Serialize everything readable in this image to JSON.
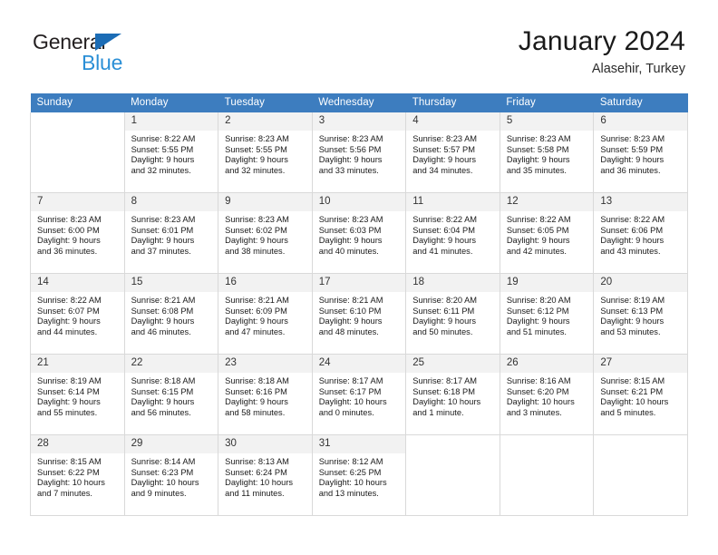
{
  "brand": {
    "name_part1": "General",
    "name_part2": "Blue",
    "accent_color": "#2b8fd6",
    "triangle_color": "#1b6cb5"
  },
  "header": {
    "title": "January 2024",
    "subtitle": "Alasehir, Turkey",
    "header_bg": "#3d7dbf"
  },
  "weekdays": [
    "Sunday",
    "Monday",
    "Tuesday",
    "Wednesday",
    "Thursday",
    "Friday",
    "Saturday"
  ],
  "labels": {
    "sunrise_prefix": "Sunrise:",
    "sunset_prefix": "Sunset:",
    "daylight_prefix": "Daylight:"
  },
  "weeks": [
    [
      {
        "day": "",
        "sunrise": "",
        "sunset": "",
        "daylight_line1": "",
        "daylight_line2": ""
      },
      {
        "day": "1",
        "sunrise": "Sunrise: 8:22 AM",
        "sunset": "Sunset: 5:55 PM",
        "daylight_line1": "Daylight: 9 hours",
        "daylight_line2": "and 32 minutes."
      },
      {
        "day": "2",
        "sunrise": "Sunrise: 8:23 AM",
        "sunset": "Sunset: 5:55 PM",
        "daylight_line1": "Daylight: 9 hours",
        "daylight_line2": "and 32 minutes."
      },
      {
        "day": "3",
        "sunrise": "Sunrise: 8:23 AM",
        "sunset": "Sunset: 5:56 PM",
        "daylight_line1": "Daylight: 9 hours",
        "daylight_line2": "and 33 minutes."
      },
      {
        "day": "4",
        "sunrise": "Sunrise: 8:23 AM",
        "sunset": "Sunset: 5:57 PM",
        "daylight_line1": "Daylight: 9 hours",
        "daylight_line2": "and 34 minutes."
      },
      {
        "day": "5",
        "sunrise": "Sunrise: 8:23 AM",
        "sunset": "Sunset: 5:58 PM",
        "daylight_line1": "Daylight: 9 hours",
        "daylight_line2": "and 35 minutes."
      },
      {
        "day": "6",
        "sunrise": "Sunrise: 8:23 AM",
        "sunset": "Sunset: 5:59 PM",
        "daylight_line1": "Daylight: 9 hours",
        "daylight_line2": "and 36 minutes."
      }
    ],
    [
      {
        "day": "7",
        "sunrise": "Sunrise: 8:23 AM",
        "sunset": "Sunset: 6:00 PM",
        "daylight_line1": "Daylight: 9 hours",
        "daylight_line2": "and 36 minutes."
      },
      {
        "day": "8",
        "sunrise": "Sunrise: 8:23 AM",
        "sunset": "Sunset: 6:01 PM",
        "daylight_line1": "Daylight: 9 hours",
        "daylight_line2": "and 37 minutes."
      },
      {
        "day": "9",
        "sunrise": "Sunrise: 8:23 AM",
        "sunset": "Sunset: 6:02 PM",
        "daylight_line1": "Daylight: 9 hours",
        "daylight_line2": "and 38 minutes."
      },
      {
        "day": "10",
        "sunrise": "Sunrise: 8:23 AM",
        "sunset": "Sunset: 6:03 PM",
        "daylight_line1": "Daylight: 9 hours",
        "daylight_line2": "and 40 minutes."
      },
      {
        "day": "11",
        "sunrise": "Sunrise: 8:22 AM",
        "sunset": "Sunset: 6:04 PM",
        "daylight_line1": "Daylight: 9 hours",
        "daylight_line2": "and 41 minutes."
      },
      {
        "day": "12",
        "sunrise": "Sunrise: 8:22 AM",
        "sunset": "Sunset: 6:05 PM",
        "daylight_line1": "Daylight: 9 hours",
        "daylight_line2": "and 42 minutes."
      },
      {
        "day": "13",
        "sunrise": "Sunrise: 8:22 AM",
        "sunset": "Sunset: 6:06 PM",
        "daylight_line1": "Daylight: 9 hours",
        "daylight_line2": "and 43 minutes."
      }
    ],
    [
      {
        "day": "14",
        "sunrise": "Sunrise: 8:22 AM",
        "sunset": "Sunset: 6:07 PM",
        "daylight_line1": "Daylight: 9 hours",
        "daylight_line2": "and 44 minutes."
      },
      {
        "day": "15",
        "sunrise": "Sunrise: 8:21 AM",
        "sunset": "Sunset: 6:08 PM",
        "daylight_line1": "Daylight: 9 hours",
        "daylight_line2": "and 46 minutes."
      },
      {
        "day": "16",
        "sunrise": "Sunrise: 8:21 AM",
        "sunset": "Sunset: 6:09 PM",
        "daylight_line1": "Daylight: 9 hours",
        "daylight_line2": "and 47 minutes."
      },
      {
        "day": "17",
        "sunrise": "Sunrise: 8:21 AM",
        "sunset": "Sunset: 6:10 PM",
        "daylight_line1": "Daylight: 9 hours",
        "daylight_line2": "and 48 minutes."
      },
      {
        "day": "18",
        "sunrise": "Sunrise: 8:20 AM",
        "sunset": "Sunset: 6:11 PM",
        "daylight_line1": "Daylight: 9 hours",
        "daylight_line2": "and 50 minutes."
      },
      {
        "day": "19",
        "sunrise": "Sunrise: 8:20 AM",
        "sunset": "Sunset: 6:12 PM",
        "daylight_line1": "Daylight: 9 hours",
        "daylight_line2": "and 51 minutes."
      },
      {
        "day": "20",
        "sunrise": "Sunrise: 8:19 AM",
        "sunset": "Sunset: 6:13 PM",
        "daylight_line1": "Daylight: 9 hours",
        "daylight_line2": "and 53 minutes."
      }
    ],
    [
      {
        "day": "21",
        "sunrise": "Sunrise: 8:19 AM",
        "sunset": "Sunset: 6:14 PM",
        "daylight_line1": "Daylight: 9 hours",
        "daylight_line2": "and 55 minutes."
      },
      {
        "day": "22",
        "sunrise": "Sunrise: 8:18 AM",
        "sunset": "Sunset: 6:15 PM",
        "daylight_line1": "Daylight: 9 hours",
        "daylight_line2": "and 56 minutes."
      },
      {
        "day": "23",
        "sunrise": "Sunrise: 8:18 AM",
        "sunset": "Sunset: 6:16 PM",
        "daylight_line1": "Daylight: 9 hours",
        "daylight_line2": "and 58 minutes."
      },
      {
        "day": "24",
        "sunrise": "Sunrise: 8:17 AM",
        "sunset": "Sunset: 6:17 PM",
        "daylight_line1": "Daylight: 10 hours",
        "daylight_line2": "and 0 minutes."
      },
      {
        "day": "25",
        "sunrise": "Sunrise: 8:17 AM",
        "sunset": "Sunset: 6:18 PM",
        "daylight_line1": "Daylight: 10 hours",
        "daylight_line2": "and 1 minute."
      },
      {
        "day": "26",
        "sunrise": "Sunrise: 8:16 AM",
        "sunset": "Sunset: 6:20 PM",
        "daylight_line1": "Daylight: 10 hours",
        "daylight_line2": "and 3 minutes."
      },
      {
        "day": "27",
        "sunrise": "Sunrise: 8:15 AM",
        "sunset": "Sunset: 6:21 PM",
        "daylight_line1": "Daylight: 10 hours",
        "daylight_line2": "and 5 minutes."
      }
    ],
    [
      {
        "day": "28",
        "sunrise": "Sunrise: 8:15 AM",
        "sunset": "Sunset: 6:22 PM",
        "daylight_line1": "Daylight: 10 hours",
        "daylight_line2": "and 7 minutes."
      },
      {
        "day": "29",
        "sunrise": "Sunrise: 8:14 AM",
        "sunset": "Sunset: 6:23 PM",
        "daylight_line1": "Daylight: 10 hours",
        "daylight_line2": "and 9 minutes."
      },
      {
        "day": "30",
        "sunrise": "Sunrise: 8:13 AM",
        "sunset": "Sunset: 6:24 PM",
        "daylight_line1": "Daylight: 10 hours",
        "daylight_line2": "and 11 minutes."
      },
      {
        "day": "31",
        "sunrise": "Sunrise: 8:12 AM",
        "sunset": "Sunset: 6:25 PM",
        "daylight_line1": "Daylight: 10 hours",
        "daylight_line2": "and 13 minutes."
      },
      {
        "day": "",
        "sunrise": "",
        "sunset": "",
        "daylight_line1": "",
        "daylight_line2": ""
      },
      {
        "day": "",
        "sunrise": "",
        "sunset": "",
        "daylight_line1": "",
        "daylight_line2": ""
      },
      {
        "day": "",
        "sunrise": "",
        "sunset": "",
        "daylight_line1": "",
        "daylight_line2": ""
      }
    ]
  ]
}
